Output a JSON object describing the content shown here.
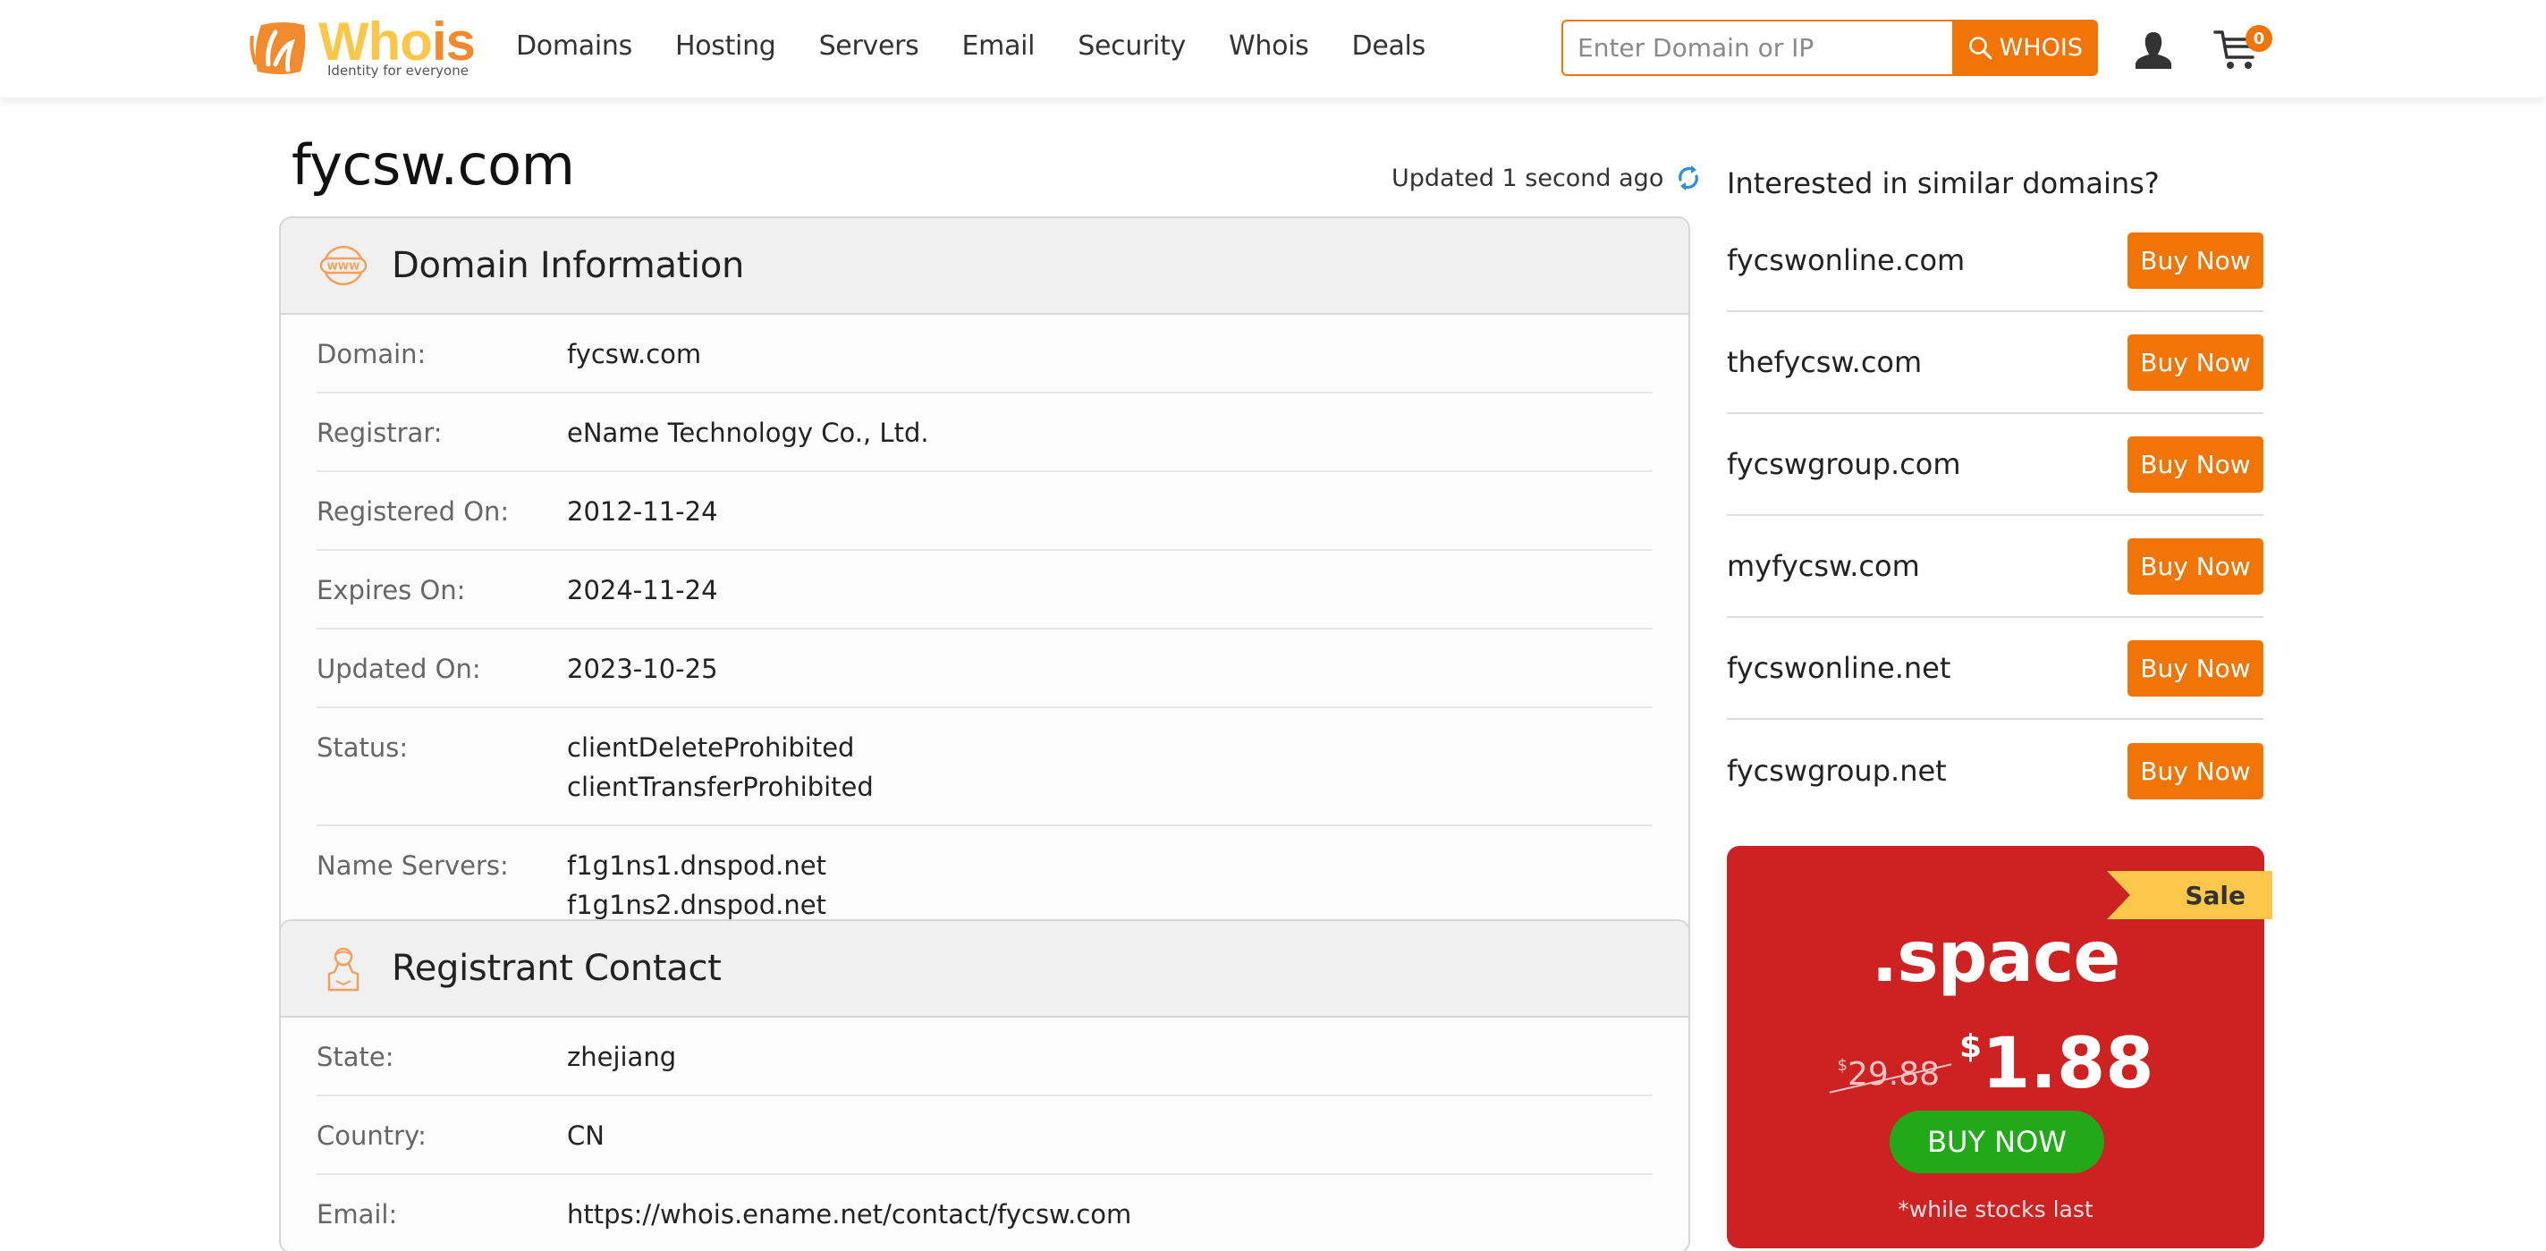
{
  "header": {
    "logo_text_main": "Who",
    "logo_text_accent": "is",
    "logo_tagline": "Identity for everyone",
    "nav": [
      "Domains",
      "Hosting",
      "Servers",
      "Email",
      "Security",
      "Whois",
      "Deals"
    ],
    "search": {
      "placeholder": "Enter Domain or IP",
      "value": "",
      "button_label": "WHOIS"
    },
    "cart_count": "0",
    "icons": {
      "user": "user-icon",
      "cart": "cart-icon",
      "search": "search-icon"
    }
  },
  "page": {
    "title": "fycsw.com",
    "updated_text": "Updated 1 second ago"
  },
  "domain_info": {
    "title": "Domain Information",
    "icon": "www-globe-icon",
    "rows": [
      {
        "label": "Domain:",
        "values": [
          "fycsw.com"
        ]
      },
      {
        "label": "Registrar:",
        "values": [
          "eName Technology Co., Ltd."
        ]
      },
      {
        "label": "Registered On:",
        "values": [
          "2012-11-24"
        ]
      },
      {
        "label": "Expires On:",
        "values": [
          "2024-11-24"
        ]
      },
      {
        "label": "Updated On:",
        "values": [
          "2023-10-25"
        ]
      },
      {
        "label": "Status:",
        "values": [
          "clientDeleteProhibited",
          "clientTransferProhibited"
        ]
      },
      {
        "label": "Name Servers:",
        "values": [
          "f1g1ns1.dnspod.net",
          "f1g1ns2.dnspod.net"
        ]
      }
    ]
  },
  "registrant": {
    "title": "Registrant Contact",
    "icon": "person-icon",
    "rows": [
      {
        "label": "State:",
        "values": [
          "zhejiang"
        ]
      },
      {
        "label": "Country:",
        "values": [
          "CN"
        ]
      },
      {
        "label": "Email:",
        "values": [
          "https://whois.ename.net/contact/fycsw.com"
        ]
      }
    ]
  },
  "sidebar": {
    "title": "Interested in similar domains?",
    "buy_label": "Buy Now",
    "domains": [
      "fycswonline.com",
      "thefycsw.com",
      "fycswgroup.com",
      "myfycsw.com",
      "fycswonline.net",
      "fycswgroup.net"
    ]
  },
  "promo": {
    "ribbon": "Sale",
    "tld": ".space",
    "currency": "$",
    "old_price": "29.88",
    "new_price": "1.88",
    "button": "BUY NOW",
    "note": "*while stocks last"
  },
  "colors": {
    "accent": "#f07406",
    "promo_bg": "#cd2122",
    "promo_button": "#22a91a",
    "ribbon": "#fdc74a",
    "refresh_icon": "#2f8ddb"
  }
}
